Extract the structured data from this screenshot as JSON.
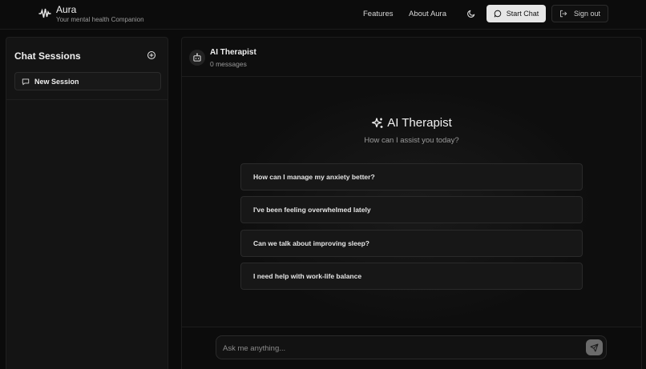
{
  "header": {
    "app_name": "Aura",
    "tagline": "Your mental health Companion",
    "nav": [
      {
        "label": "Features"
      },
      {
        "label": "About Aura"
      }
    ],
    "start_chat_label": "Start Chat",
    "sign_out_label": "Sign out",
    "icons": {
      "brand": "waveform-icon",
      "theme": "moon-icon",
      "start_chat": "message-circle-icon",
      "sign_out": "log-out-icon"
    }
  },
  "sidebar": {
    "title": "Chat Sessions",
    "new_session_label": "New Session",
    "icons": {
      "add": "plus-circle-icon",
      "session": "message-square-icon"
    }
  },
  "chat": {
    "title": "AI Therapist",
    "message_count": "0 messages",
    "hero_title": "AI Therapist",
    "hero_subtitle": "How can I assist you today?",
    "suggestions": [
      "How can I manage my anxiety better?",
      "I've been feeling overwhelmed lately",
      "Can we talk about improving sleep?",
      "I need help with work-life balance"
    ],
    "input_placeholder": "Ask me anything...",
    "icons": {
      "avatar": "bot-icon",
      "hero": "sparkles-icon",
      "send": "send-icon"
    }
  },
  "colors": {
    "background": "#0b0b0b",
    "panel": "#141414",
    "accent_button": "#e6e6e6"
  }
}
